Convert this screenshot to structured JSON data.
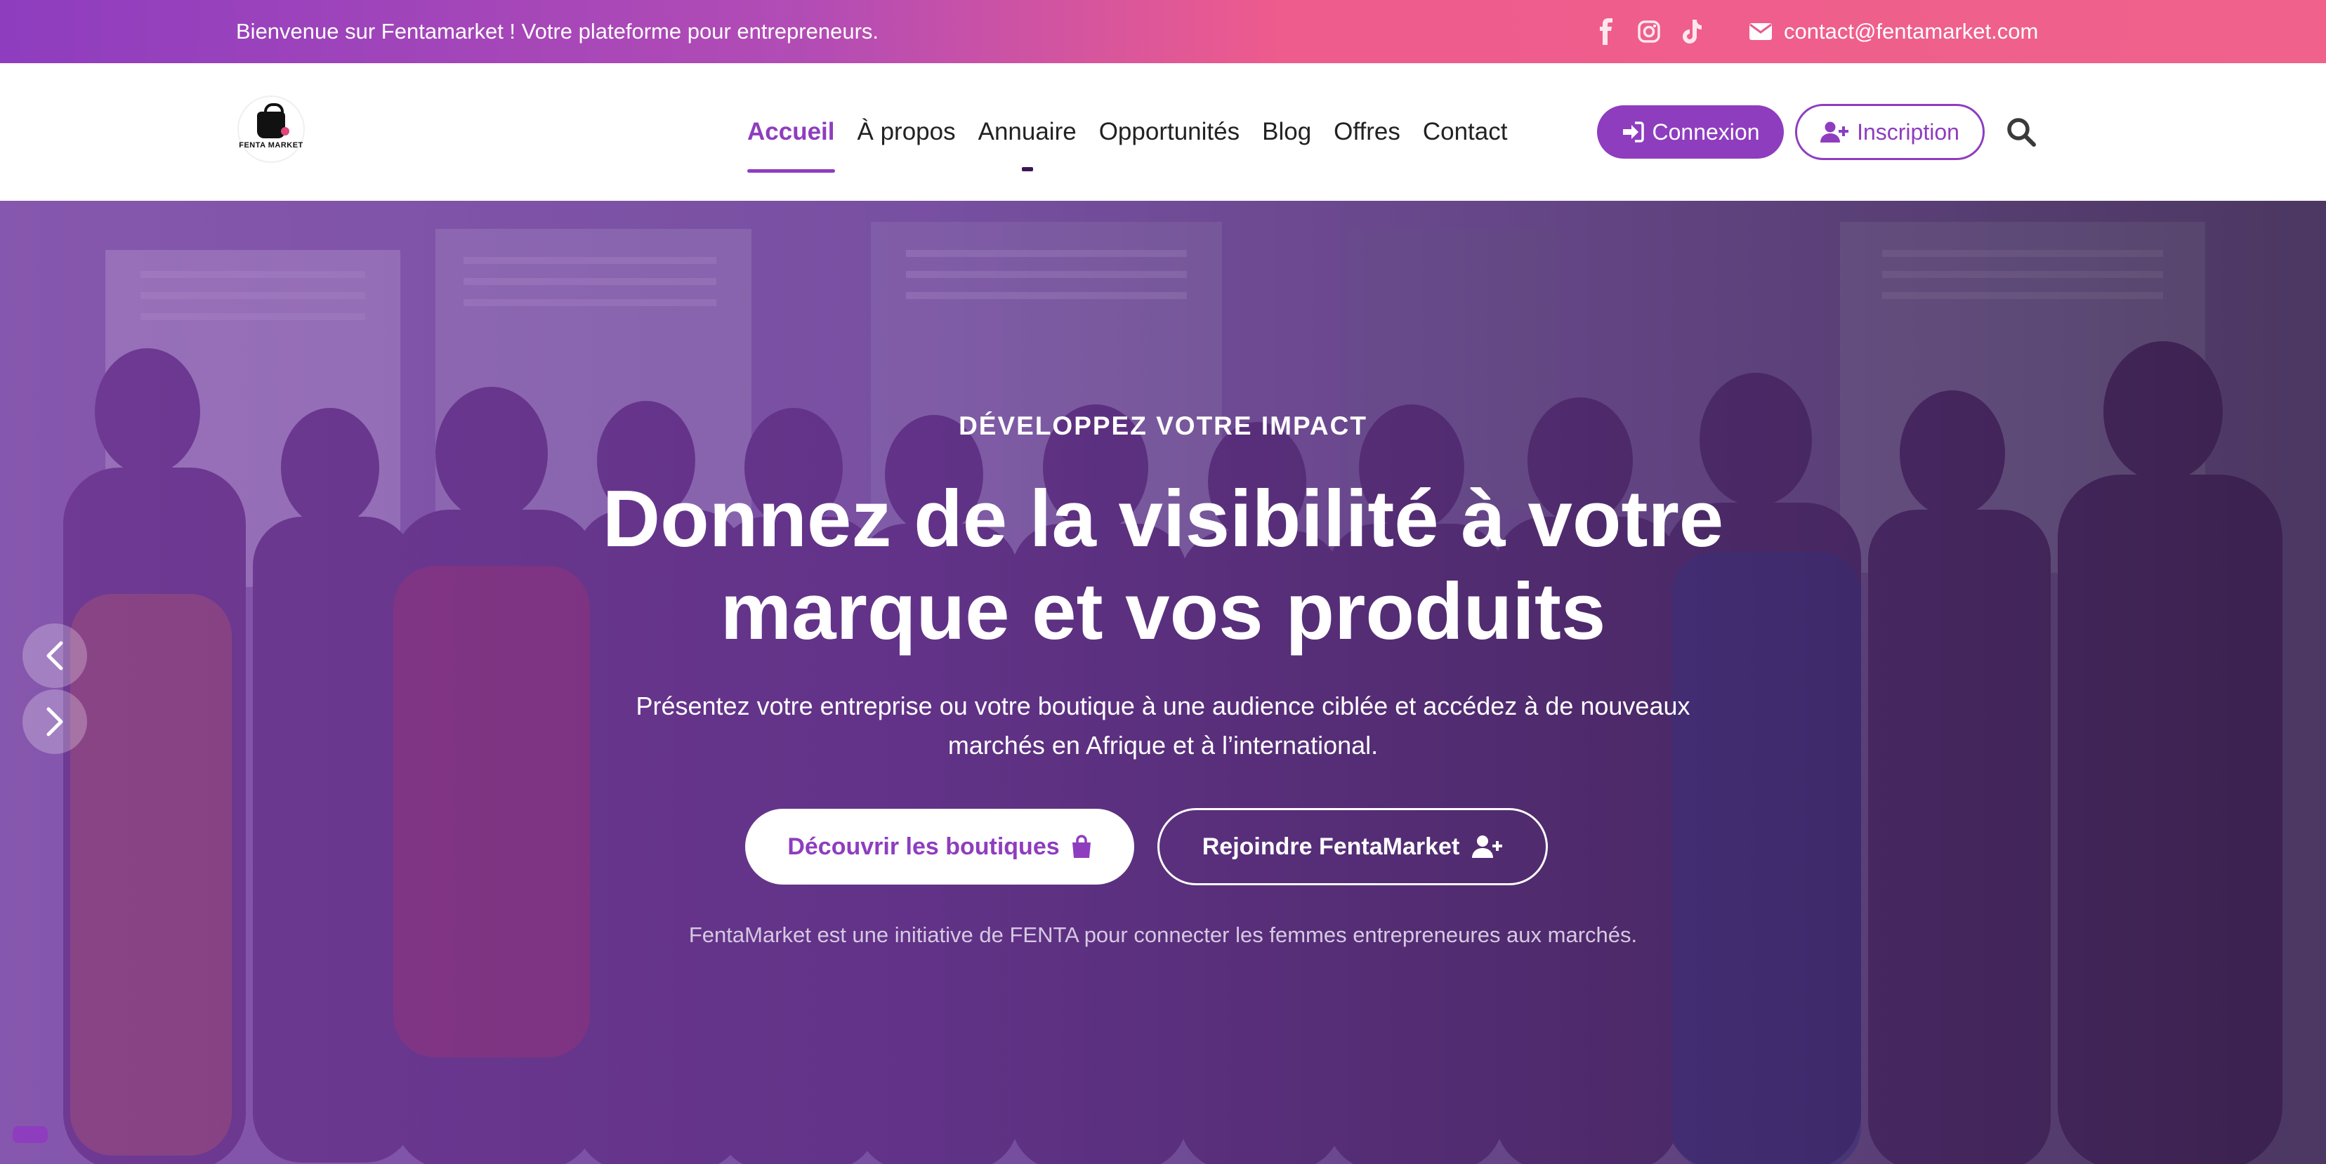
{
  "topbar": {
    "welcome": "Bienvenue sur Fentamarket ! Votre plateforme pour entrepreneurs.",
    "socials": [
      "facebook-icon",
      "instagram-icon",
      "tiktok-icon"
    ],
    "email": "contact@fentamarket.com"
  },
  "logo": {
    "text": "FENTA MARKET",
    "sub": "—"
  },
  "nav": {
    "items": [
      "Accueil",
      "À propos",
      "Annuaire",
      "Opportunités",
      "Blog",
      "Offres",
      "Contact"
    ],
    "active": "Accueil",
    "login": "Connexion",
    "signup": "Inscription"
  },
  "hero": {
    "eyebrow": "DÉVELOPPEZ VOTRE IMPACT",
    "title_line1": "Donnez de la visibilité à votre",
    "title_line2": "marque et vos produits",
    "lead_line1": "Présentez votre entreprise ou votre boutique à une audience ciblée et accédez à de nouveaux",
    "lead_line2": "marchés en Afrique et à l’international.",
    "cta_primary": "Découvrir les boutiques",
    "cta_secondary": "Rejoindre FentaMarket",
    "footnote": "FentaMarket est une initiative de FENTA pour connecter les femmes entrepreneures aux marchés."
  },
  "colors": {
    "brand": "#8e3dbf",
    "pink": "#f0628c",
    "white": "#ffffff"
  }
}
